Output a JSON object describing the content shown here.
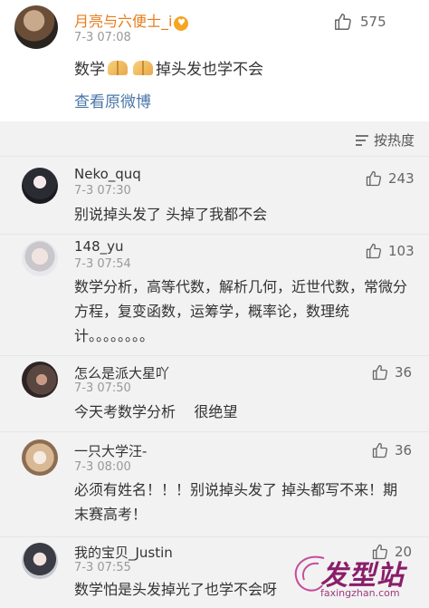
{
  "post": {
    "author": "月亮与六便士_i",
    "time": "7-3 07:08",
    "likes": "575",
    "text_prefix": "数学",
    "text_suffix": "掉头发也学不会",
    "view_original": "查看原微博"
  },
  "sort": {
    "label": "按热度",
    "icon": "sort-lines-icon"
  },
  "comments": [
    {
      "name": "Neko_quq",
      "time": "7-3 07:30",
      "likes": "243",
      "text": "别说掉头发了 头掉了我都不会"
    },
    {
      "name": "148_yu",
      "time": "7-3 07:54",
      "likes": "103",
      "text": "数学分析，高等代数，解析几何，近世代数，常微分方程，复变函数，运筹学，概率论，数理统计。。。。。。。。"
    },
    {
      "name": "怎么是派大星吖",
      "time": "7-3 07:50",
      "likes": "36",
      "text": "今天考数学分析    很绝望"
    },
    {
      "name": "一只大学汪-",
      "time": "7-3 08:00",
      "likes": "36",
      "text": "必须有姓名！！！别说掉头发了 掉头都写不来！期末赛高考！"
    },
    {
      "name": "我的宝贝_Justin",
      "time": "7-3 07:55",
      "likes": "20",
      "text": "数学怕是头发掉光了也学不会呀"
    }
  ],
  "watermark": {
    "logo": "发型站",
    "url": "faxingzhan.com"
  },
  "colors": {
    "author": "#e87c19",
    "link": "#4a76a8",
    "muted": "#999999",
    "background": "#f2f2f2"
  }
}
